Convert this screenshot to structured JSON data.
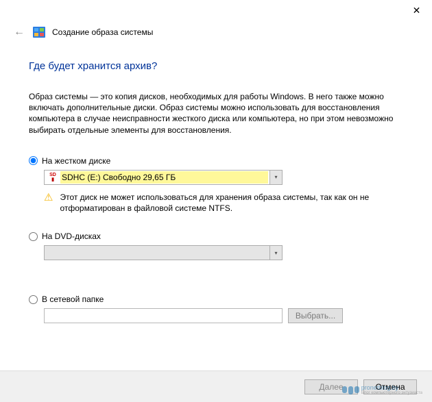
{
  "titlebar": {
    "close": "✕"
  },
  "header": {
    "back": "←",
    "title": "Создание образа системы"
  },
  "heading": "Где будет хранится архив?",
  "description": "Образ системы — это копия дисков, необходимых для работы Windows. В него также можно включать дополнительные диски. Образ системы можно использовать для восстановления компьютера в случае неисправности жесткого диска или компьютера, но при этом невозможно выбирать отдельные элементы для восстановления.",
  "options": {
    "hdd": {
      "label": "На жестком диске",
      "selected_value": "SDHC (E:)  Свободно 29,65 ГБ",
      "warning": "Этот диск не может использоваться для хранения образа системы, так как он не отформатирован в файловой системе NTFS."
    },
    "dvd": {
      "label": "На DVD-дисках"
    },
    "network": {
      "label": "В сетевой папке",
      "value": "",
      "browse": "Выбрать..."
    }
  },
  "footer": {
    "next": "Далее",
    "cancel": "Отмена"
  },
  "watermark": {
    "site": "pronetblog.by",
    "sub": "Блог компьютерного энтузиаста"
  }
}
